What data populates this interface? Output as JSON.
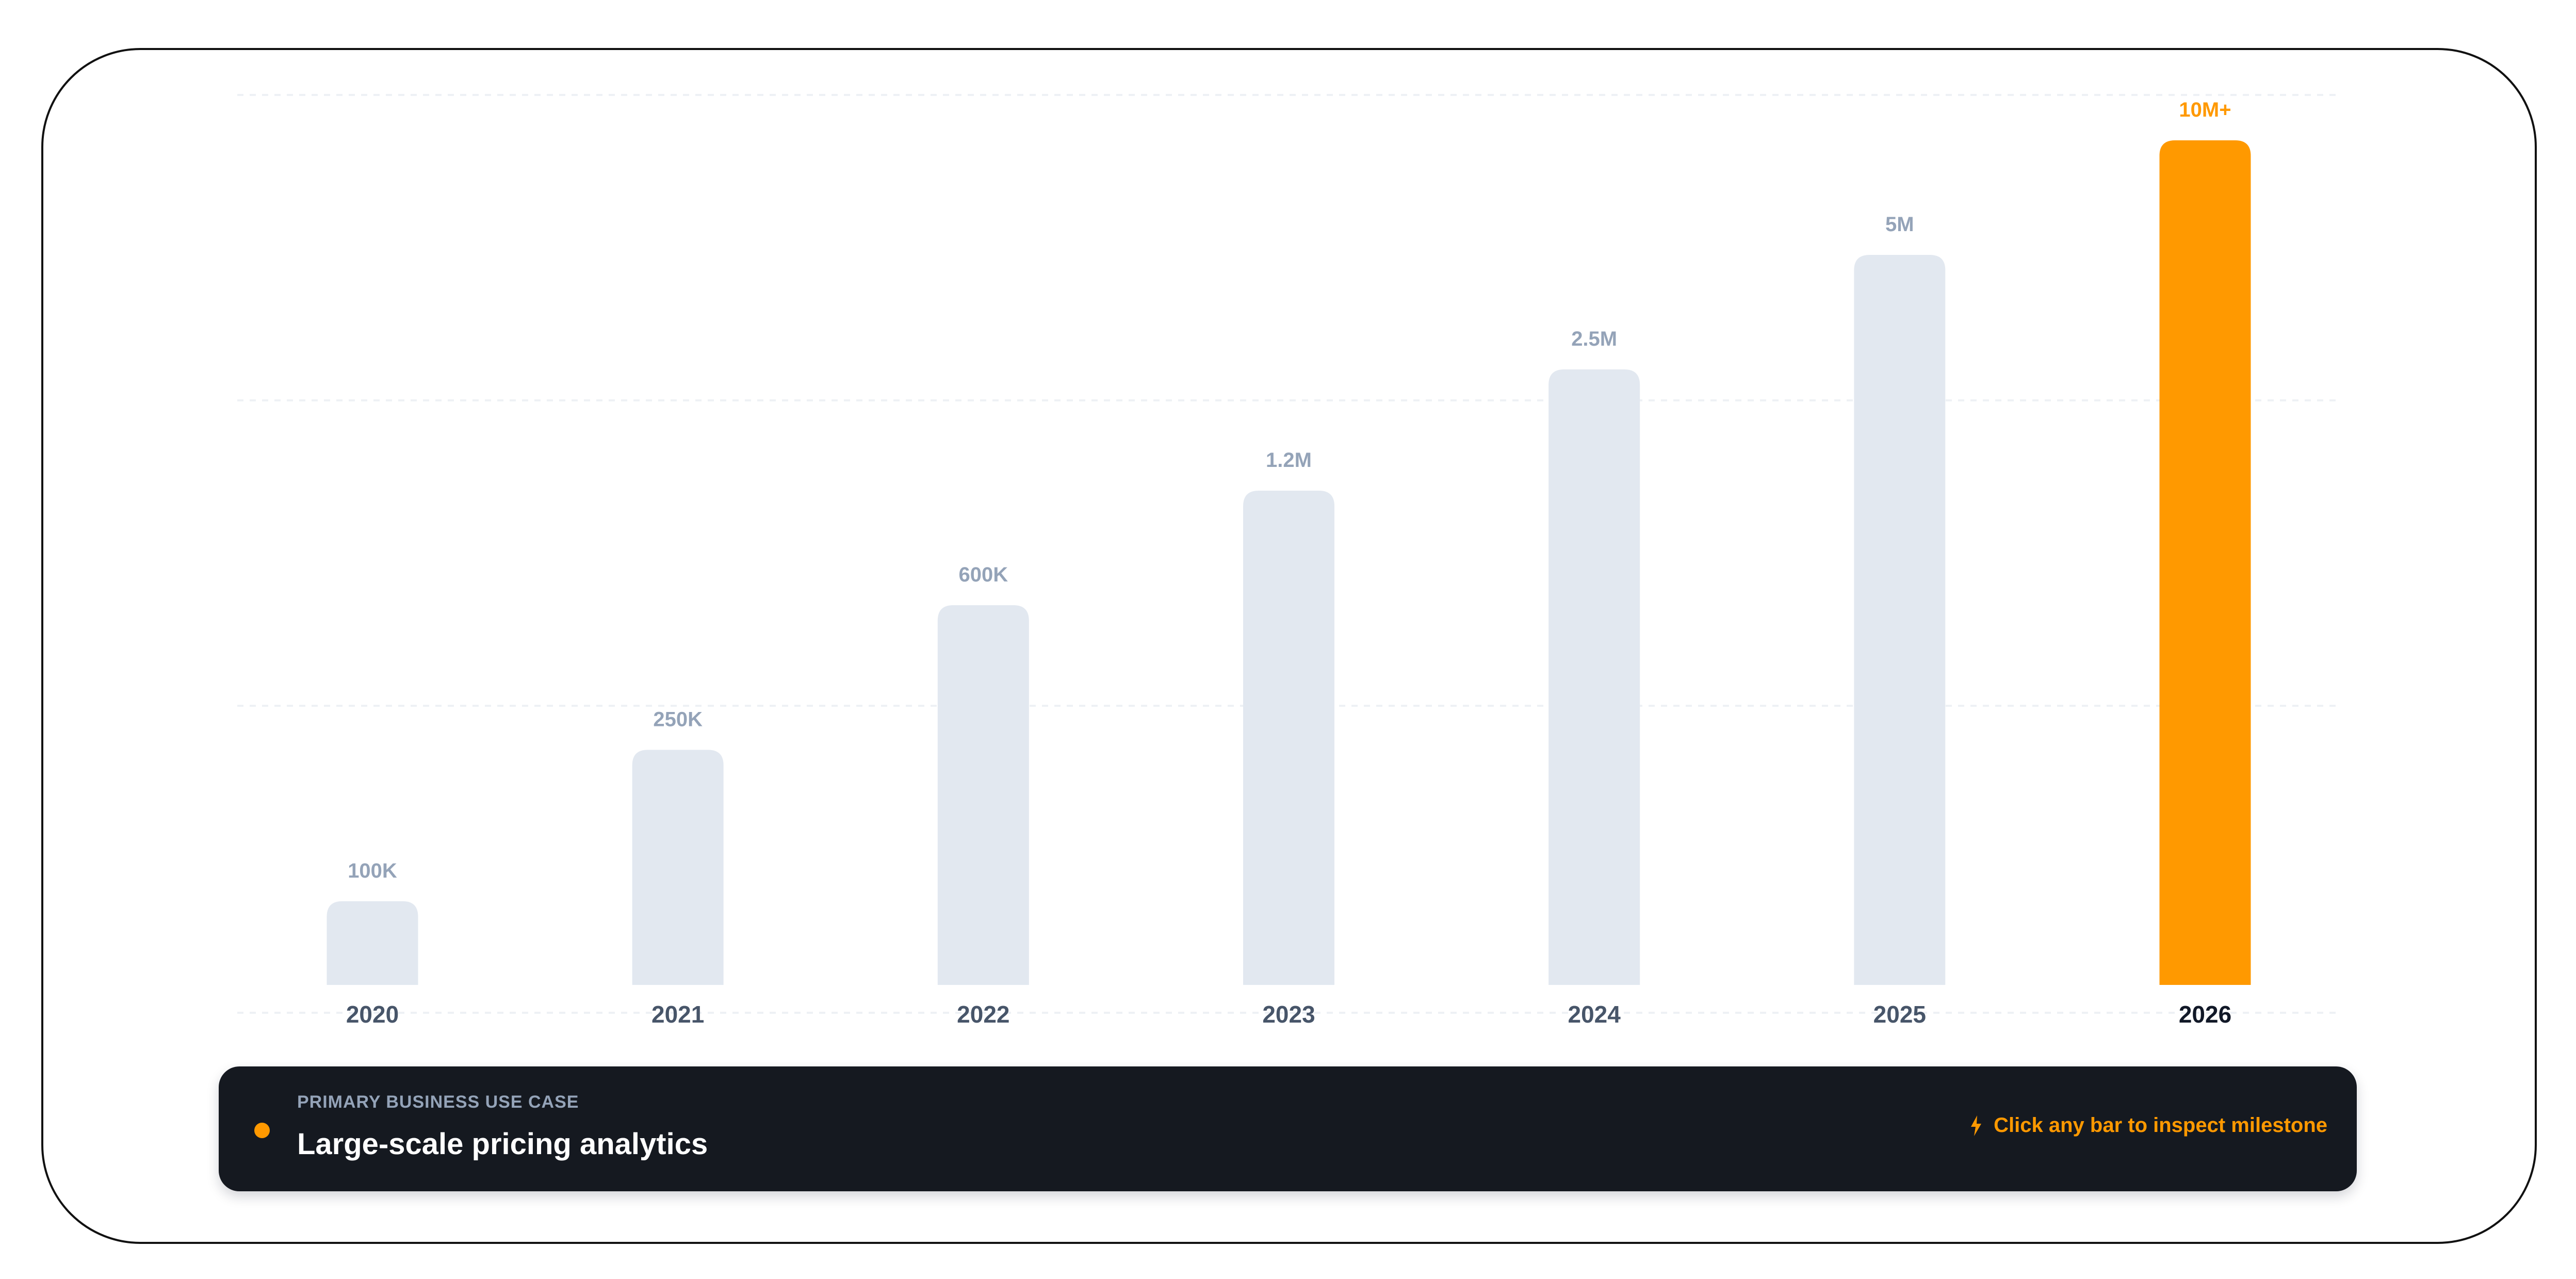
{
  "chart_data": {
    "type": "bar",
    "categories": [
      "2020",
      "2021",
      "2022",
      "2023",
      "2024",
      "2025",
      "2026"
    ],
    "values": [
      100000,
      250000,
      600000,
      1200000,
      2500000,
      5000000,
      10000000
    ],
    "value_labels": [
      "100K",
      "250K",
      "600K",
      "1.2M",
      "2.5M",
      "5M",
      "10M+"
    ],
    "highlight_index": 6,
    "bar_color": "#e2e8f0",
    "highlight_color": "#ff9900",
    "label_color": "#94a3b8",
    "title": "",
    "xlabel": "",
    "ylabel": "",
    "grid": true,
    "legend": "none"
  },
  "info": {
    "kicker": "PRIMARY BUSINESS USE CASE",
    "title": "Large-scale pricing analytics",
    "hint": "Click any bar to inspect milestone",
    "hint_icon": "bolt-icon",
    "dot_color": "#ff9900"
  }
}
